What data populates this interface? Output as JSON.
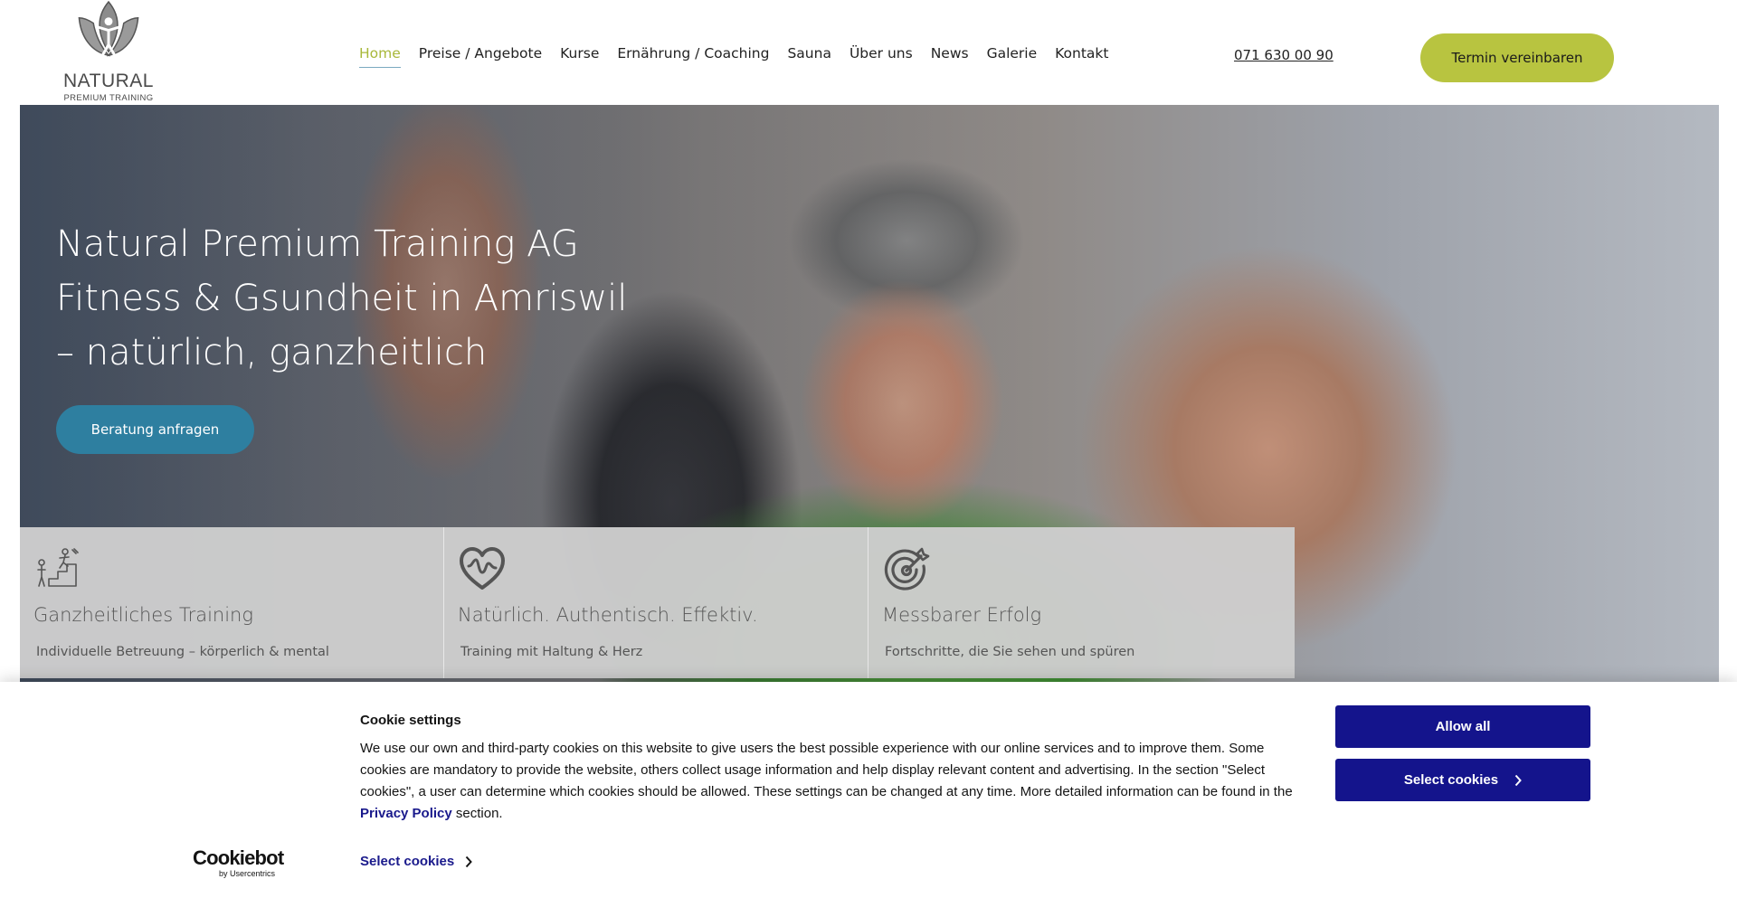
{
  "header": {
    "logo": {
      "word": "NATURAL",
      "sub": "PREMIUM TRAINING"
    },
    "nav": [
      {
        "label": "Home",
        "active": true
      },
      {
        "label": "Preise / Angebote"
      },
      {
        "label": "Kurse"
      },
      {
        "label": "Ernährung / Coaching"
      },
      {
        "label": "Sauna"
      },
      {
        "label": "Über uns"
      },
      {
        "label": "News"
      },
      {
        "label": "Galerie"
      },
      {
        "label": "Kontakt"
      }
    ],
    "phone": "071 630 00 90",
    "cta_label": "Termin vereinbaren"
  },
  "hero": {
    "title_lines": [
      "Natural Premium Training AG",
      "Fitness & Gsundheit in Amriswil",
      "– natürlich, ganzheitlich"
    ],
    "button_label": "Beratung anfragen"
  },
  "features": [
    {
      "icon": "training-steps-icon",
      "title": "Ganzheitliches Training",
      "subtitle": "Individuelle Betreuung – körperlich & mental"
    },
    {
      "icon": "heart-pulse-icon",
      "title": "Natürlich. Authentisch. Effektiv.",
      "subtitle": "Training mit Haltung & Herz"
    },
    {
      "icon": "target-icon",
      "title": "Messbarer Erfolg",
      "subtitle": "Fortschritte, die Sie sehen und spüren"
    }
  ],
  "cookie": {
    "brand": "Cookiebot",
    "brand_sub": "by Usercentrics",
    "title": "Cookie settings",
    "text_before": "We use our own and third-party cookies on this website to give users the best possible experience with our online services and to improve them. Some cookies are mandatory to provide the website, others collect usage information and help display relevant content and advertising. In the section \"Select cookies\", a user can determine which cookies should be allowed. These settings can be changed at any time. More detailed information can be found in the",
    "link_label": "Privacy Policy",
    "text_after": "section.",
    "select_link_label": "Select cookies",
    "allow_all_label": "Allow all",
    "select_button_label": "Select cookies"
  },
  "colors": {
    "accent_green": "#b8c440",
    "nav_active": "#a8b83a",
    "hero_button": "#2e7fa0",
    "cookie_primary": "#14148c"
  }
}
